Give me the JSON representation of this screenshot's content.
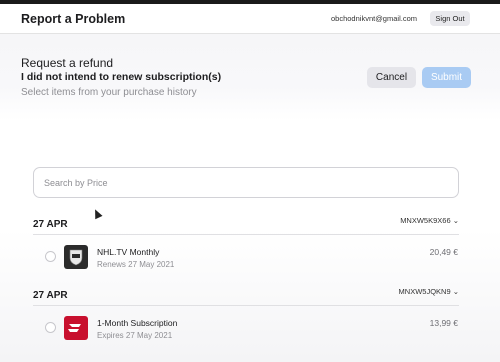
{
  "header": {
    "title": "Report a Problem",
    "email": "obchodnikvnt@gmail.com",
    "sign_out": "Sign Out"
  },
  "refund": {
    "title": "Request a refund",
    "reason": "I did not intend to renew subscription(s)",
    "hint": "Select items from your purchase history",
    "cancel": "Cancel",
    "submit": "Submit"
  },
  "search": {
    "placeholder": "Search by Price"
  },
  "groups": [
    {
      "date": "27 APR",
      "order": "MNXW5K9X66 ⌄",
      "item": {
        "name": "NHL.TV Monthly",
        "sub": "Renews 27 May 2021",
        "price": "20,49 €",
        "icon": "nhl-logo-icon"
      }
    },
    {
      "date": "27 APR",
      "order": "MNXW5JQKN9 ⌄",
      "item": {
        "name": "1-Month Subscription",
        "sub": "Expires 27 May 2021",
        "price": "13,99 €",
        "icon": "expressvpn-logo-icon"
      }
    }
  ],
  "colors": {
    "accent_disabled": "#a9cbf3",
    "nhl_bg": "#2b2b2b",
    "ep_red": "#c8102e"
  }
}
